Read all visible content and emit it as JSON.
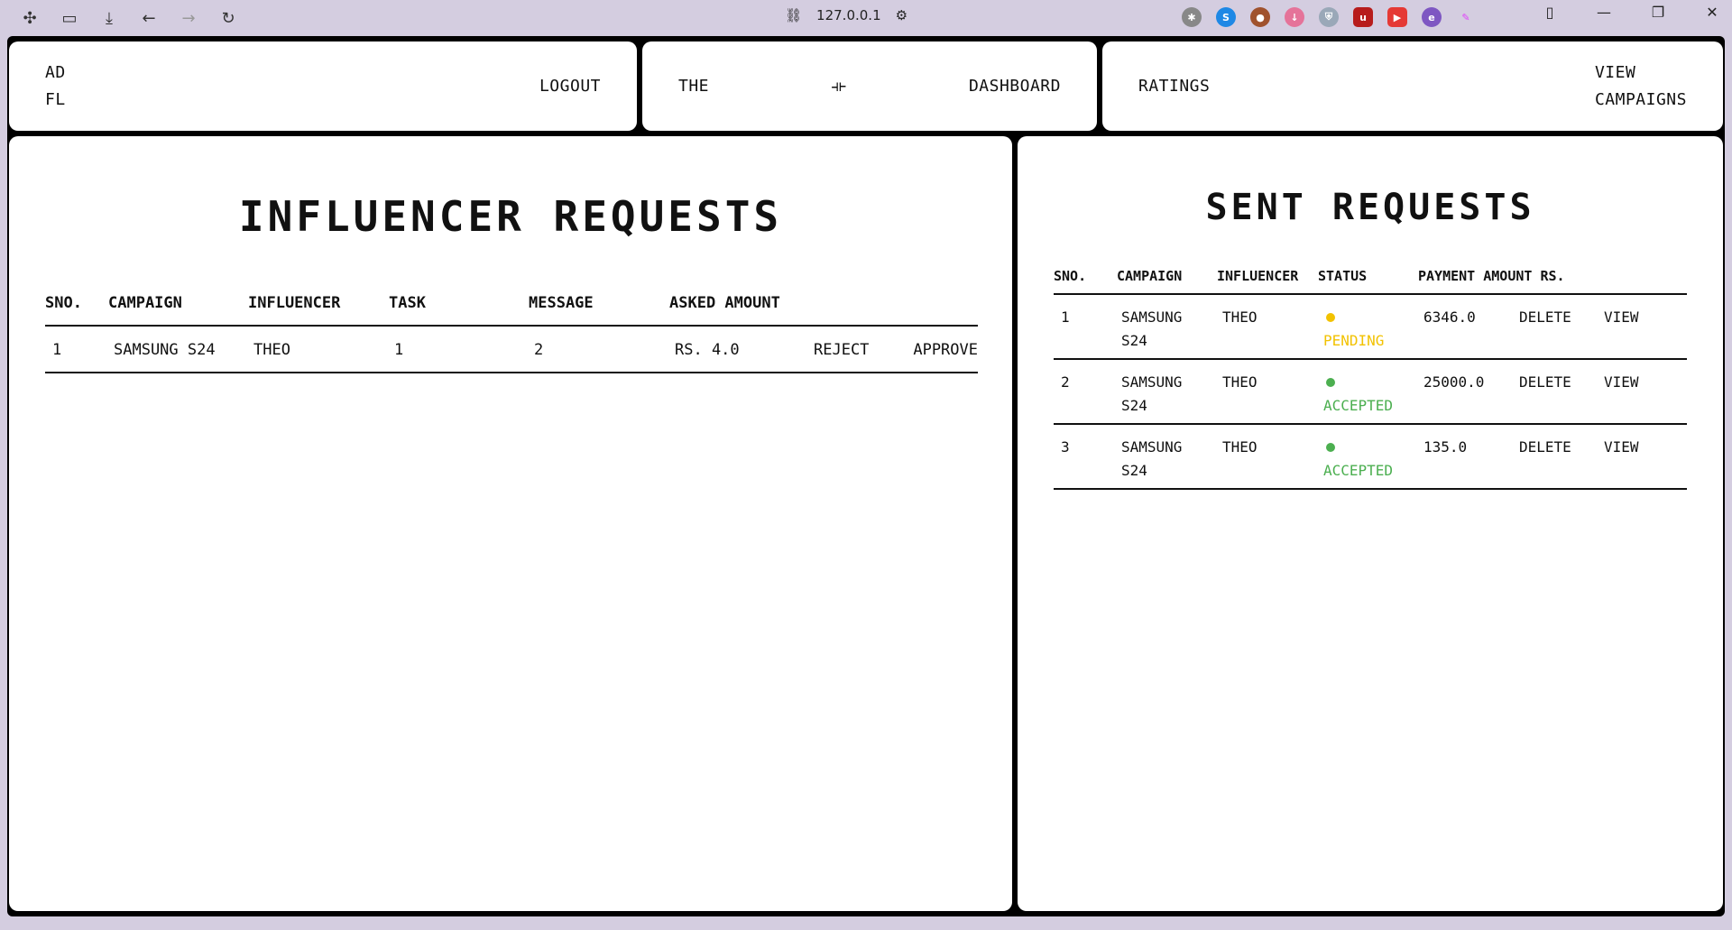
{
  "browser": {
    "url": "127.0.0.1"
  },
  "navbar": {
    "brand_line1": "AD",
    "brand_line2": "FL",
    "logout": "LOGOUT",
    "the": "THE",
    "logo_glyph": "⟛",
    "dashboard": "DASHBOARD",
    "ratings": "RATINGS",
    "view_campaigns_line1": "VIEW",
    "view_campaigns_line2": "CAMPAIGNS"
  },
  "influencer_requests": {
    "title": "INFLUENCER REQUESTS",
    "columns": [
      "SNO.",
      "CAMPAIGN",
      "INFLUENCER",
      "TASK",
      "MESSAGE",
      "ASKED AMOUNT"
    ],
    "rows": [
      {
        "sno": "1",
        "campaign": "SAMSUNG S24",
        "influencer": "THEO",
        "task": "1",
        "message": "2",
        "amount": "RS. 4.0",
        "reject": "REJECT",
        "approve": "APPROVE"
      }
    ]
  },
  "sent_requests": {
    "title": "SENT REQUESTS",
    "columns": [
      "SNO.",
      "CAMPAIGN",
      "INFLUENCER",
      "STATUS",
      "PAYMENT AMOUNT RS."
    ],
    "rows": [
      {
        "sno": "1",
        "campaign_line1": "SAMSUNG",
        "campaign_line2": "S24",
        "influencer": "THEO",
        "status": "PENDING",
        "status_color": "#f2c200",
        "amount": "6346.0",
        "delete": "DELETE",
        "view": "VIEW"
      },
      {
        "sno": "2",
        "campaign_line1": "SAMSUNG",
        "campaign_line2": "S24",
        "influencer": "THEO",
        "status": "ACCEPTED",
        "status_color": "#4caf50",
        "amount": "25000.0",
        "delete": "DELETE",
        "view": "VIEW"
      },
      {
        "sno": "3",
        "campaign_line1": "SAMSUNG",
        "campaign_line2": "S24",
        "influencer": "THEO",
        "status": "ACCEPTED",
        "status_color": "#4caf50",
        "amount": "135.0",
        "delete": "DELETE",
        "view": "VIEW"
      }
    ]
  }
}
